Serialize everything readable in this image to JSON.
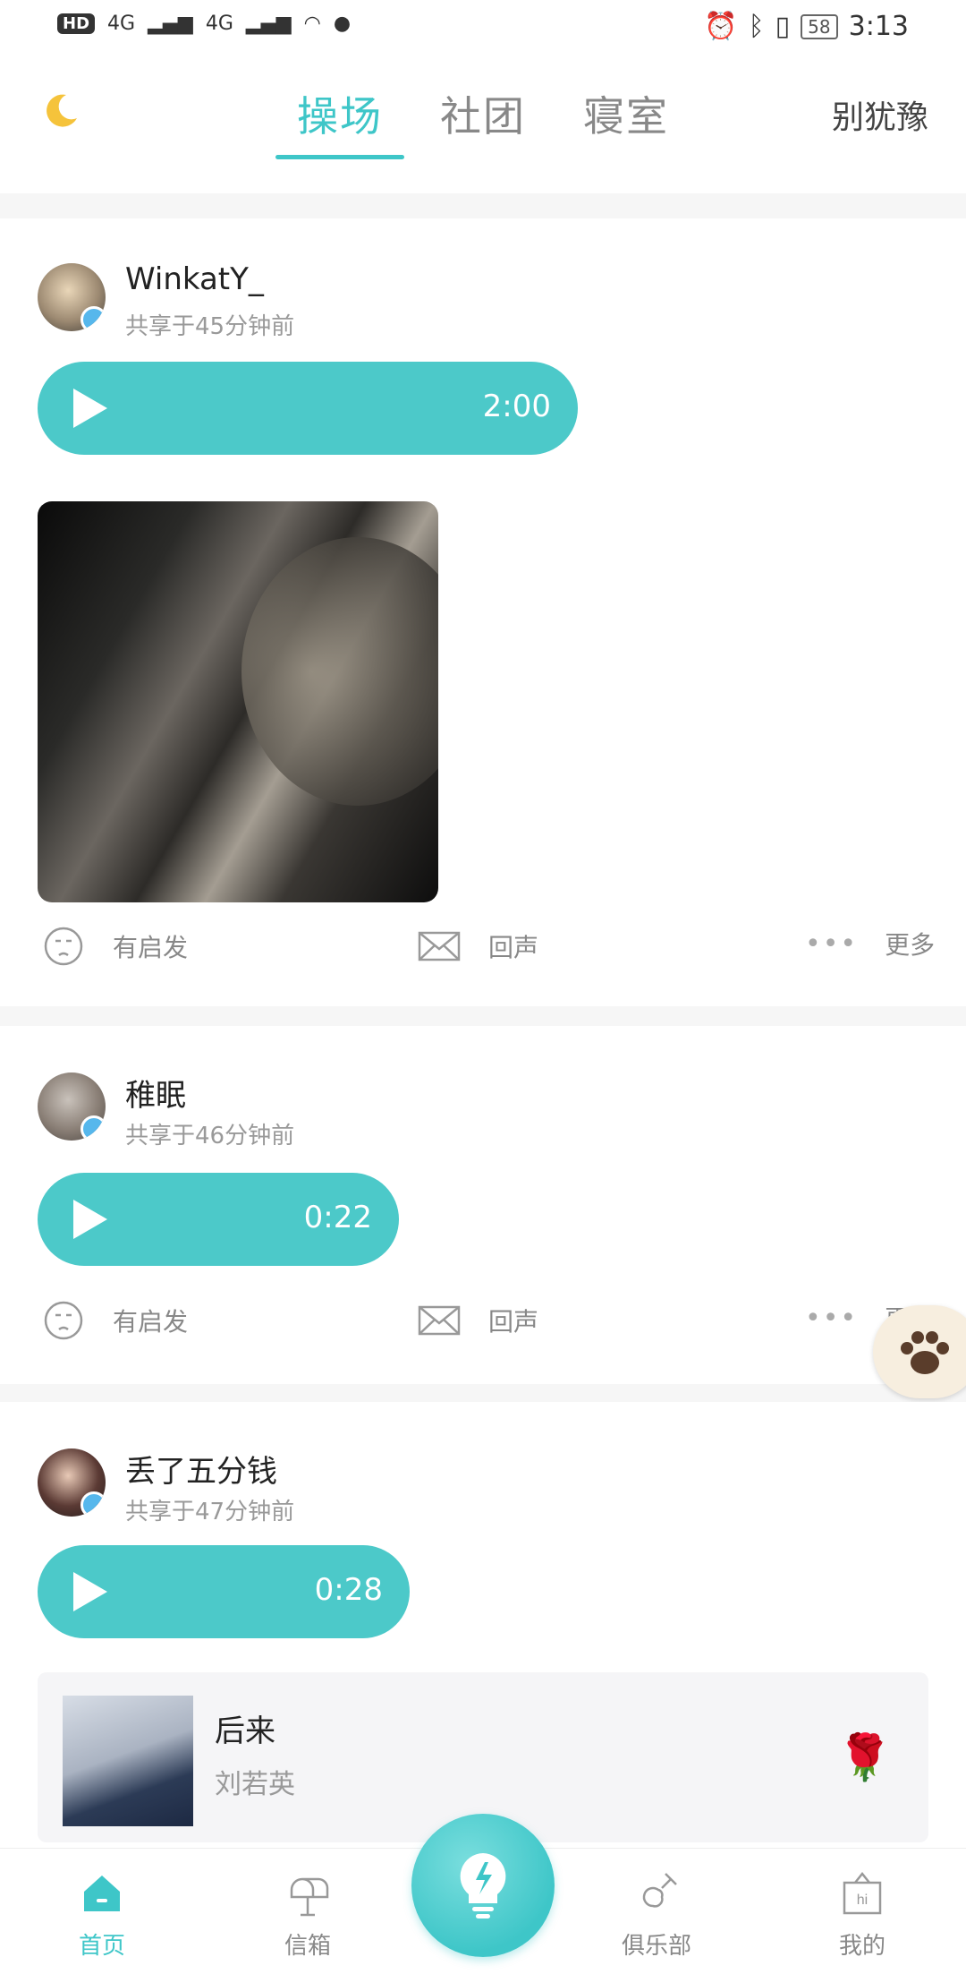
{
  "status_bar": {
    "left": [
      "HD",
      "4G",
      "4G"
    ],
    "battery": "58",
    "time": "3:13"
  },
  "topnav": {
    "tabs": [
      {
        "label": "操场",
        "active": true
      },
      {
        "label": "社团",
        "active": false
      },
      {
        "label": "寝室",
        "active": false
      }
    ],
    "right_link": "别犹豫",
    "accent": "#3ec6c8"
  },
  "posts": [
    {
      "user": "WinkatY_",
      "time": "共享于45分钟前",
      "duration": "2:00",
      "actions": {
        "inspire": "有启发",
        "echo": "回声",
        "more": "更多"
      }
    },
    {
      "user": "稚眠",
      "time": "共享于46分钟前",
      "duration": "0:22",
      "actions": {
        "inspire": "有启发",
        "echo": "回声",
        "more": "更多"
      }
    },
    {
      "user": "丢了五分钱",
      "time": "共享于47分钟前",
      "duration": "0:28",
      "music": {
        "title": "后来",
        "artist": "刘若英"
      }
    }
  ],
  "bottom_nav": [
    {
      "label": "首页",
      "icon": "home-icon",
      "active": true
    },
    {
      "label": "信箱",
      "icon": "mailbox-icon",
      "active": false
    },
    {
      "label": "俱乐部",
      "icon": "guitar-icon",
      "active": false
    },
    {
      "label": "我的",
      "icon": "hi-sign-icon",
      "active": false
    }
  ]
}
